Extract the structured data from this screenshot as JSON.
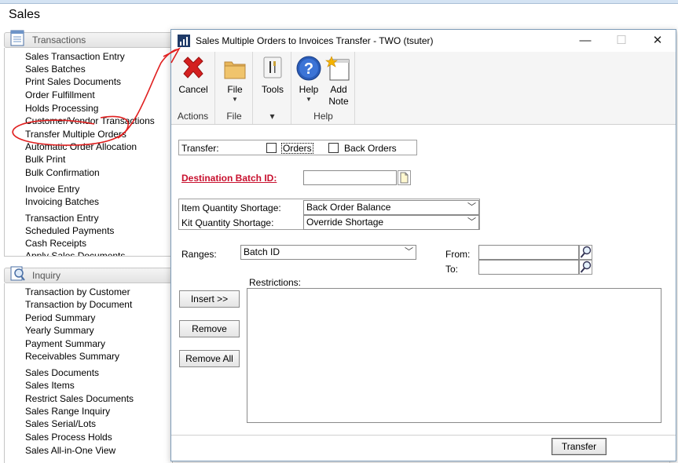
{
  "page": {
    "title": "Sales"
  },
  "transactions_section": {
    "header": "Transactions",
    "links": [
      "Sales Transaction Entry",
      "Sales Batches",
      "Print Sales Documents",
      "Order Fulfillment",
      "Holds Processing",
      "Customer/Vendor Transactions",
      "Transfer Multiple Orders",
      "Automatic Order Allocation",
      "Bulk Print",
      "Bulk Confirmation",
      "Invoice Entry",
      "Invoicing Batches",
      "Transaction Entry",
      "Scheduled Payments",
      "Cash Receipts",
      "Apply Sales Documents"
    ]
  },
  "inquiry_section": {
    "header": "Inquiry",
    "links": [
      "Transaction by Customer",
      "Transaction by Document",
      "Period Summary",
      "Yearly Summary",
      "Payment Summary",
      "Receivables Summary",
      "Sales Documents",
      "Sales Items",
      "Restrict Sales Documents",
      "Sales Range Inquiry",
      "Sales Serial/Lots",
      "Sales Process Holds",
      "Sales All-in-One View"
    ]
  },
  "dialog": {
    "title": "Sales Multiple Orders to Invoices Transfer  -  TWO (tsuter)",
    "window_buttons": {
      "minimize": "—",
      "maximize": "☐",
      "close": "✕"
    },
    "ribbon": {
      "cancel": "Cancel",
      "file": "File",
      "tools": "Tools",
      "help": "Help",
      "add_note_line1": "Add",
      "add_note_line2": "Note",
      "groups": {
        "actions": "Actions",
        "file": "File",
        "tools_more": "▾",
        "help": "Help"
      }
    },
    "form": {
      "transfer_label": "Transfer:",
      "orders_label": "Orders",
      "orders_checked": false,
      "back_orders_label": "Back Orders",
      "back_orders_checked": false,
      "destination_batch_label": "Destination Batch ID:",
      "destination_batch_value": "",
      "item_qty_shortage_label": "Item Quantity Shortage:",
      "item_qty_shortage_value": "Back Order Balance",
      "kit_qty_shortage_label": "Kit Quantity Shortage:",
      "kit_qty_shortage_value": "Override Shortage",
      "ranges_label": "Ranges:",
      "ranges_value": "Batch ID",
      "from_label": "From:",
      "from_value": "",
      "to_label": "To:",
      "to_value": "",
      "restrictions_label": "Restrictions:",
      "insert_button": "Insert >>",
      "remove_button": "Remove",
      "remove_all_button": "Remove All",
      "transfer_button": "Transfer"
    }
  },
  "colors": {
    "required_label": "#c8102e",
    "annotation": "#e02020",
    "ribbon_bg": "#f5f5f5",
    "window_border": "#7f9db9"
  }
}
